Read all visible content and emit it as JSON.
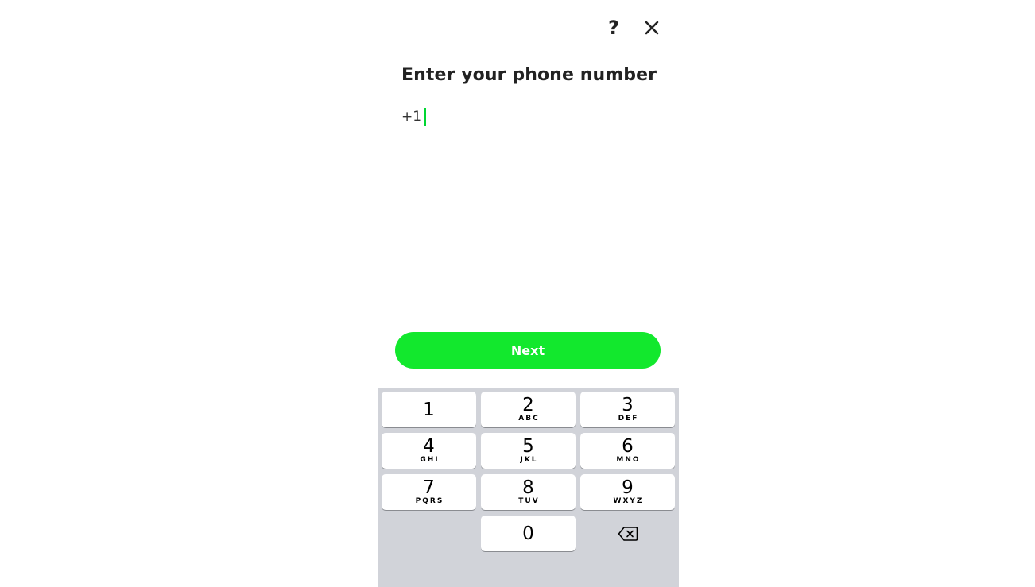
{
  "header": {
    "help_icon": "question-mark-icon",
    "help_glyph": "?",
    "close_icon": "close-icon"
  },
  "title": "Enter your phone number",
  "phone_input": {
    "value": "+1",
    "caret_color": "#00d632"
  },
  "next_button": {
    "label": "Next",
    "color": "#12e82d"
  },
  "keypad": {
    "background": "#d1d3d9",
    "keys": [
      {
        "digit": "1",
        "letters": ""
      },
      {
        "digit": "2",
        "letters": "ABC"
      },
      {
        "digit": "3",
        "letters": "DEF"
      },
      {
        "digit": "4",
        "letters": "GHI"
      },
      {
        "digit": "5",
        "letters": "JKL"
      },
      {
        "digit": "6",
        "letters": "MNO"
      },
      {
        "digit": "7",
        "letters": "PQRS"
      },
      {
        "digit": "8",
        "letters": "TUV"
      },
      {
        "digit": "9",
        "letters": "WXYZ"
      },
      {
        "digit": "0",
        "letters": ""
      }
    ],
    "backspace_icon": "backspace-icon"
  }
}
